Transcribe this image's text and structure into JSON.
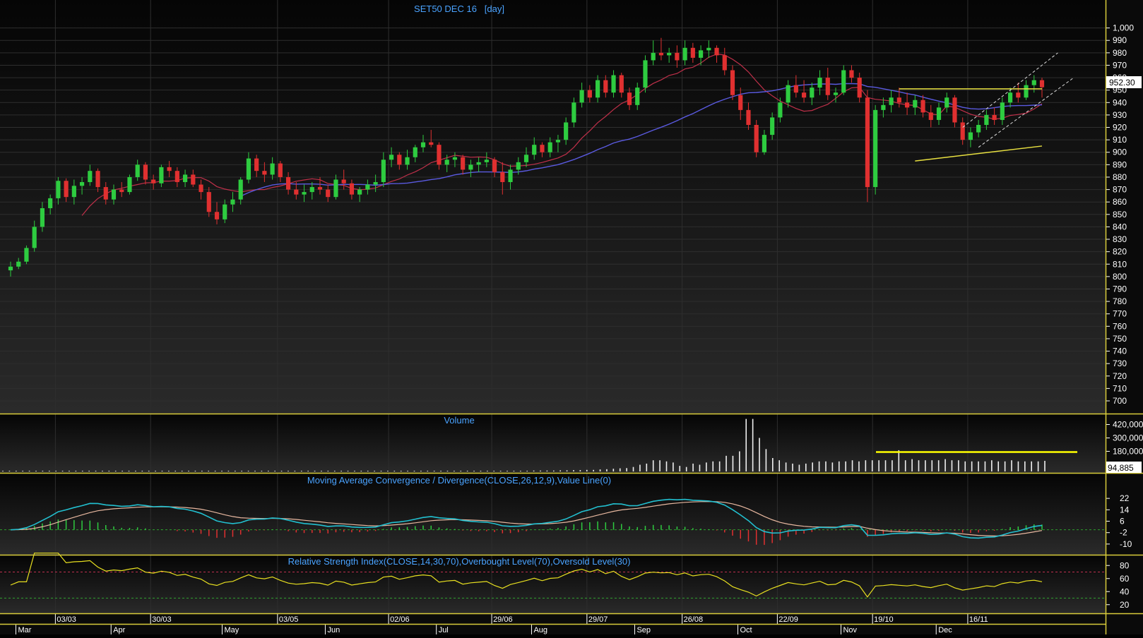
{
  "colors": {
    "background": "#0a0a0a",
    "panel_top": "#050505",
    "panel_bottom": "#2a2a2a",
    "grid": "#2e2e2e",
    "border": "#d8cc3a",
    "axis_text": "#ffffff",
    "title_text": "#4aa3ff",
    "up": "#2ecc40",
    "down": "#e03030",
    "ma_short": "#c0304a",
    "ma_long": "#5a5ae0",
    "macd_line": "#22c0d0",
    "signal_line": "#e8b8a0",
    "rsi_line": "#e8e020",
    "trend": "#e8e040",
    "channel": "#dddddd",
    "price_tag_bg": "#ffffff",
    "price_tag_text": "#000000"
  },
  "panels": {
    "price_title": "SET50 DEC 16   [day]",
    "volume_title": "Volume",
    "macd_title": "Moving Average Convergence / Divergence(CLOSE,26,12,9),Value Line(0)",
    "rsi_title": "Relative Strength Index(CLOSE,14,30,70),Overbought Level(70),Oversold Level(30)"
  },
  "chart_data": [
    {
      "type": "candlestick",
      "title": "SET50 DEC 16   [day]",
      "ylim": [
        690,
        1000
      ],
      "y_ticks": [
        "1,000",
        "990",
        "980",
        "970",
        "960",
        "950",
        "940",
        "930",
        "920",
        "910",
        "900",
        "890",
        "880",
        "870",
        "860",
        "850",
        "840",
        "830",
        "820",
        "810",
        "800",
        "790",
        "780",
        "770",
        "760",
        "750",
        "740",
        "730",
        "720",
        "710",
        "700"
      ],
      "last_price_label": "952.30",
      "last_price": 952.3,
      "date_ticks": [
        "03/03",
        "30/03",
        "03/05",
        "02/06",
        "29/06",
        "29/07",
        "26/08",
        "22/09",
        "19/10",
        "16/11"
      ],
      "month_ticks": [
        "Mar",
        "Apr",
        "May",
        "Jun",
        "Jul",
        "Aug",
        "Sep",
        "Oct",
        "Nov",
        "Dec"
      ],
      "ohlc": [
        [
          805,
          812,
          800,
          808
        ],
        [
          808,
          815,
          806,
          812
        ],
        [
          812,
          825,
          810,
          823
        ],
        [
          823,
          845,
          820,
          840
        ],
        [
          840,
          860,
          836,
          855
        ],
        [
          855,
          866,
          850,
          863
        ],
        [
          863,
          880,
          858,
          877
        ],
        [
          877,
          879,
          860,
          864
        ],
        [
          864,
          878,
          858,
          873
        ],
        [
          873,
          880,
          866,
          876
        ],
        [
          876,
          890,
          873,
          885
        ],
        [
          885,
          887,
          868,
          872
        ],
        [
          872,
          876,
          858,
          862
        ],
        [
          862,
          874,
          858,
          870
        ],
        [
          870,
          876,
          864,
          868
        ],
        [
          868,
          882,
          866,
          880
        ],
        [
          880,
          894,
          877,
          890
        ],
        [
          890,
          892,
          874,
          878
        ],
        [
          878,
          882,
          870,
          875
        ],
        [
          875,
          890,
          872,
          888
        ],
        [
          888,
          893,
          880,
          885
        ],
        [
          885,
          888,
          872,
          876
        ],
        [
          876,
          886,
          872,
          882
        ],
        [
          882,
          886,
          872,
          874
        ],
        [
          874,
          878,
          862,
          868
        ],
        [
          868,
          872,
          848,
          852
        ],
        [
          852,
          860,
          842,
          846
        ],
        [
          846,
          862,
          843,
          858
        ],
        [
          858,
          868,
          852,
          862
        ],
        [
          862,
          880,
          858,
          878
        ],
        [
          878,
          900,
          875,
          895
        ],
        [
          895,
          898,
          880,
          885
        ],
        [
          885,
          892,
          876,
          882
        ],
        [
          882,
          896,
          878,
          891
        ],
        [
          891,
          893,
          876,
          880
        ],
        [
          880,
          884,
          866,
          870
        ],
        [
          870,
          876,
          862,
          866
        ],
        [
          866,
          874,
          860,
          868
        ],
        [
          868,
          876,
          862,
          872
        ],
        [
          872,
          880,
          866,
          870
        ],
        [
          870,
          874,
          860,
          864
        ],
        [
          864,
          882,
          862,
          878
        ],
        [
          878,
          886,
          870,
          875
        ],
        [
          875,
          878,
          862,
          866
        ],
        [
          866,
          872,
          860,
          870
        ],
        [
          870,
          878,
          866,
          874
        ],
        [
          874,
          882,
          868,
          876
        ],
        [
          876,
          900,
          872,
          894
        ],
        [
          894,
          904,
          888,
          898
        ],
        [
          898,
          900,
          886,
          890
        ],
        [
          890,
          902,
          886,
          896
        ],
        [
          896,
          906,
          892,
          904
        ],
        [
          904,
          914,
          900,
          908
        ],
        [
          908,
          918,
          904,
          906
        ],
        [
          906,
          908,
          886,
          890
        ],
        [
          890,
          898,
          884,
          894
        ],
        [
          894,
          900,
          888,
          896
        ],
        [
          896,
          898,
          882,
          886
        ],
        [
          886,
          894,
          880,
          890
        ],
        [
          890,
          896,
          884,
          892
        ],
        [
          892,
          900,
          888,
          894
        ],
        [
          894,
          896,
          880,
          884
        ],
        [
          884,
          892,
          866,
          876
        ],
        [
          876,
          890,
          870,
          886
        ],
        [
          886,
          896,
          882,
          892
        ],
        [
          892,
          904,
          888,
          898
        ],
        [
          898,
          912,
          894,
          906
        ],
        [
          906,
          908,
          896,
          900
        ],
        [
          900,
          912,
          896,
          908
        ],
        [
          908,
          914,
          900,
          910
        ],
        [
          910,
          928,
          906,
          924
        ],
        [
          924,
          944,
          920,
          940
        ],
        [
          940,
          956,
          936,
          950
        ],
        [
          950,
          954,
          940,
          944
        ],
        [
          944,
          962,
          940,
          958
        ],
        [
          958,
          962,
          944,
          948
        ],
        [
          948,
          966,
          944,
          962
        ],
        [
          962,
          964,
          944,
          948
        ],
        [
          948,
          952,
          934,
          938
        ],
        [
          938,
          956,
          934,
          952
        ],
        [
          952,
          978,
          948,
          974
        ],
        [
          974,
          990,
          970,
          980
        ],
        [
          980,
          992,
          974,
          978
        ],
        [
          978,
          984,
          972,
          980
        ],
        [
          980,
          986,
          968,
          974
        ],
        [
          974,
          990,
          970,
          984
        ],
        [
          984,
          988,
          972,
          976
        ],
        [
          976,
          986,
          970,
          982
        ],
        [
          982,
          990,
          976,
          984
        ],
        [
          984,
          986,
          972,
          978
        ],
        [
          978,
          984,
          962,
          966
        ],
        [
          966,
          970,
          942,
          946
        ],
        [
          946,
          952,
          926,
          934
        ],
        [
          934,
          940,
          918,
          922
        ],
        [
          922,
          926,
          896,
          900
        ],
        [
          900,
          918,
          898,
          914
        ],
        [
          914,
          932,
          910,
          928
        ],
        [
          928,
          944,
          924,
          940
        ],
        [
          940,
          958,
          936,
          954
        ],
        [
          954,
          962,
          944,
          948
        ],
        [
          948,
          958,
          940,
          944
        ],
        [
          944,
          956,
          938,
          952
        ],
        [
          952,
          966,
          946,
          960
        ],
        [
          960,
          968,
          942,
          946
        ],
        [
          946,
          952,
          940,
          948
        ],
        [
          948,
          970,
          946,
          966
        ],
        [
          966,
          970,
          956,
          960
        ],
        [
          960,
          964,
          940,
          944
        ],
        [
          944,
          950,
          860,
          872
        ],
        [
          872,
          938,
          866,
          934
        ],
        [
          934,
          944,
          928,
          938
        ],
        [
          938,
          950,
          932,
          944
        ],
        [
          944,
          952,
          936,
          940
        ],
        [
          940,
          948,
          930,
          936
        ],
        [
          936,
          946,
          930,
          942
        ],
        [
          942,
          946,
          928,
          932
        ],
        [
          932,
          938,
          920,
          926
        ],
        [
          926,
          940,
          922,
          936
        ],
        [
          936,
          948,
          932,
          944
        ],
        [
          944,
          946,
          920,
          924
        ],
        [
          924,
          928,
          906,
          910
        ],
        [
          910,
          920,
          904,
          916
        ],
        [
          916,
          926,
          912,
          922
        ],
        [
          922,
          934,
          918,
          930
        ],
        [
          930,
          936,
          922,
          926
        ],
        [
          926,
          944,
          922,
          940
        ],
        [
          940,
          952,
          936,
          948
        ],
        [
          948,
          956,
          940,
          944
        ],
        [
          944,
          958,
          942,
          954
        ],
        [
          954,
          962,
          948,
          958
        ],
        [
          958,
          960,
          944,
          952.3
        ]
      ],
      "volume": {
        "y_ticks": [
          "420,000",
          "300,000",
          "180,000"
        ],
        "last_label": "94,885",
        "ylim": [
          0,
          480000
        ],
        "values": [
          6000,
          6000,
          6000,
          6000,
          6000,
          6000,
          6000,
          6000,
          6000,
          6000,
          6000,
          6000,
          6000,
          6000,
          6000,
          6000,
          6000,
          6000,
          6000,
          6000,
          6000,
          6000,
          6000,
          6000,
          6000,
          6000,
          6000,
          6000,
          6000,
          6000,
          6000,
          6000,
          6000,
          6000,
          6000,
          6000,
          6000,
          6000,
          6000,
          6000,
          6000,
          6000,
          6000,
          6000,
          6000,
          6000,
          6000,
          6000,
          6000,
          6000,
          6000,
          6000,
          6000,
          6000,
          6000,
          6000,
          6000,
          6000,
          6000,
          6000,
          6000,
          6000,
          6000,
          6000,
          6000,
          6000,
          6000,
          6000,
          6000,
          6000,
          6000,
          6000,
          6000,
          6000,
          6000,
          6000,
          6000,
          6000,
          6000,
          6000,
          8000,
          8000,
          8000,
          8000,
          10000,
          10000,
          12000,
          12000,
          14000,
          14000,
          18000,
          20000,
          24000,
          28000,
          30000,
          40000,
          60000,
          70000,
          100000,
          100000,
          90000,
          80000,
          50000,
          40000,
          70000,
          60000,
          80000,
          90000,
          90000,
          140000,
          140000,
          180000,
          470000,
          470000,
          300000,
          200000,
          120000,
          100000,
          80000,
          70000,
          60000,
          70000,
          80000,
          90000,
          90000,
          80000,
          90000,
          90000,
          100000,
          90000,
          100000,
          100000,
          100000,
          100000,
          100000,
          190000,
          100000,
          110000,
          100000,
          100000,
          100000,
          100000,
          110000,
          100000,
          100000,
          90000,
          90000,
          90000,
          90000,
          100000,
          90000,
          90000,
          100000,
          90000,
          90000,
          90000,
          90000,
          94885
        ]
      },
      "macd": {
        "y_ticks": [
          "22",
          "14",
          "6",
          "-2",
          "-10"
        ],
        "ylim": [
          -16,
          30
        ]
      },
      "rsi": {
        "y_ticks": [
          "80",
          "60",
          "40",
          "20"
        ],
        "ylim": [
          10,
          90
        ],
        "overbought": 70,
        "oversold": 30
      }
    }
  ]
}
